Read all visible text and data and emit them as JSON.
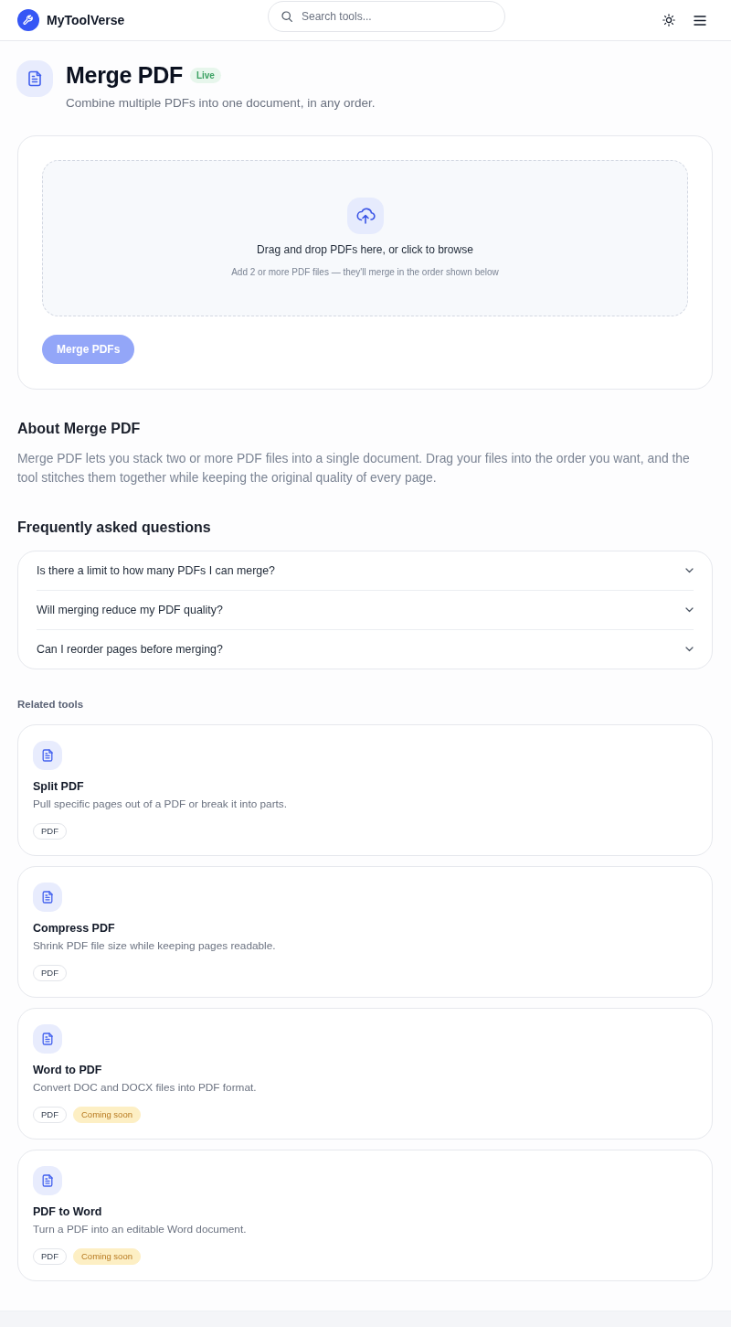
{
  "header": {
    "brand": "MyToolVerse",
    "search": {
      "placeholder": "Search tools..."
    }
  },
  "tool": {
    "title": "Merge PDF",
    "status": "Live",
    "subtitle": "Combine multiple PDFs into one document, in any order."
  },
  "upload": {
    "prompt": "Drag and drop PDFs here, or click to browse",
    "hint": "Add 2 or more PDF files — they'll merge in the order shown below",
    "button": {
      "label": "Merge PDFs",
      "disabled": true
    }
  },
  "about": {
    "heading": "About Merge PDF",
    "text": "Merge PDF lets you stack two or more PDF files into a single document. Drag your files into the order you want, and the tool stitches them together while keeping the original quality of every page."
  },
  "faq": {
    "heading": "Frequently asked questions",
    "items": [
      {
        "question": "Is there a limit to how many PDFs I can merge?",
        "expanded": false
      },
      {
        "question": "Will merging reduce my PDF quality?",
        "expanded": false
      },
      {
        "question": "Can I reorder pages before merging?",
        "expanded": false
      }
    ]
  },
  "related": {
    "heading": "Related tools",
    "tools": [
      {
        "name": "Split PDF",
        "description": "Pull specific pages out of a PDF or break it into parts.",
        "tags": [
          {
            "label": "PDF",
            "kind": "format"
          }
        ]
      },
      {
        "name": "Compress PDF",
        "description": "Shrink PDF file size while keeping pages readable.",
        "tags": [
          {
            "label": "PDF",
            "kind": "format"
          }
        ]
      },
      {
        "name": "Word to PDF",
        "description": "Convert DOC and DOCX files into PDF format.",
        "tags": [
          {
            "label": "PDF",
            "kind": "format"
          },
          {
            "label": "Coming soon",
            "kind": "status"
          }
        ]
      },
      {
        "name": "PDF to Word",
        "description": "Turn a PDF into an editable Word document.",
        "tags": [
          {
            "label": "PDF",
            "kind": "format"
          },
          {
            "label": "Coming soon",
            "kind": "status"
          }
        ]
      }
    ]
  }
}
